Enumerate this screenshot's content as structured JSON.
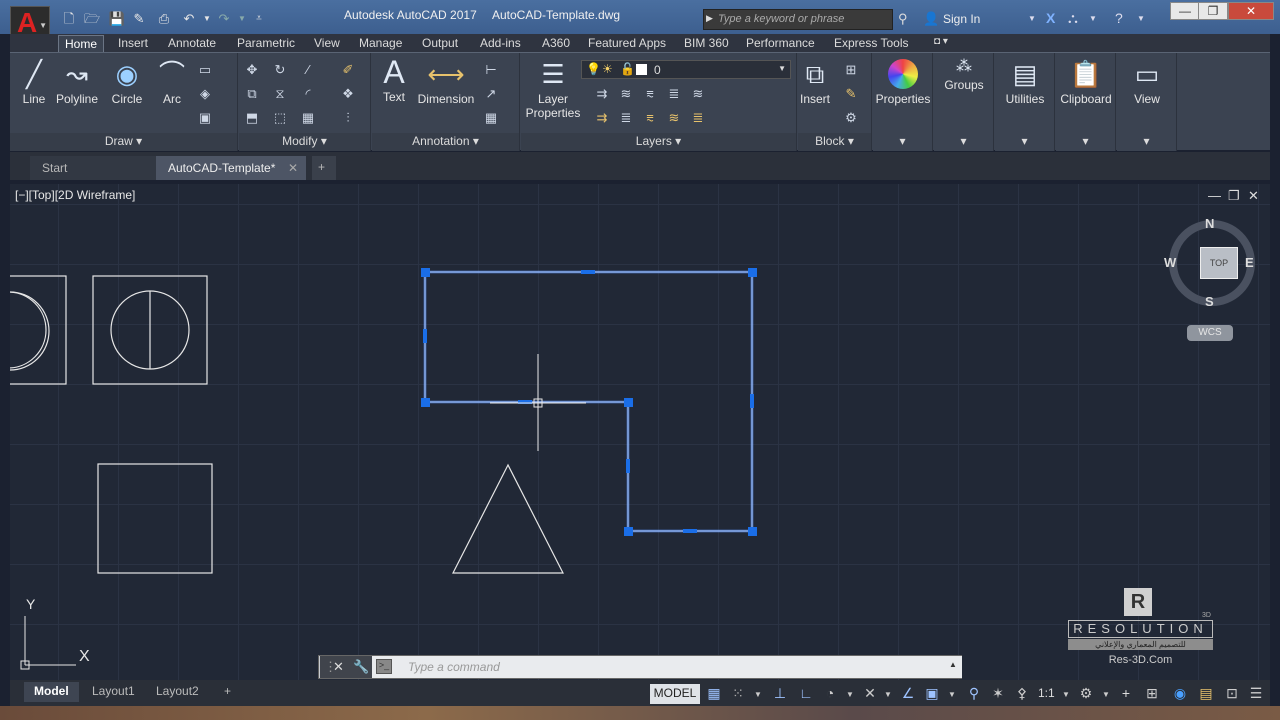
{
  "window": {
    "app_title": "Autodesk AutoCAD 2017",
    "file_title": "AutoCAD-Template.dwg",
    "search_placeholder": "Type a keyword or phrase",
    "sign_in": "Sign In"
  },
  "ribbon_tabs": [
    "Home",
    "Insert",
    "Annotate",
    "Parametric",
    "View",
    "Manage",
    "Output",
    "Add-ins",
    "A360",
    "Featured Apps",
    "BIM 360",
    "Performance",
    "Express Tools"
  ],
  "ribbon": {
    "draw": {
      "footer": "Draw",
      "line": "Line",
      "polyline": "Polyline",
      "circle": "Circle",
      "arc": "Arc"
    },
    "modify": {
      "footer": "Modify"
    },
    "annotation": {
      "footer": "Annotation",
      "text": "Text",
      "dimension": "Dimension"
    },
    "layers": {
      "footer": "Layers",
      "layer_properties_1": "Layer",
      "layer_properties_2": "Properties",
      "current_layer": "0"
    },
    "block": {
      "footer": "Block",
      "insert": "Insert"
    },
    "properties": "Properties",
    "groups": "Groups",
    "utilities": "Utilities",
    "clipboard": "Clipboard",
    "view": "View"
  },
  "doc_tabs": {
    "start": "Start",
    "active": "AutoCAD-Template*"
  },
  "viewport": {
    "label": "[−][Top][2D Wireframe]",
    "viewcube_face": "TOP",
    "compass": {
      "n": "N",
      "s": "S",
      "e": "E",
      "w": "W"
    },
    "wcs": "WCS",
    "ucs_x": "X",
    "ucs_y": "Y"
  },
  "command_line": {
    "placeholder": "Type a command"
  },
  "layout_tabs": {
    "model": "Model",
    "layout1": "Layout1",
    "layout2": "Layout2"
  },
  "status_bar": {
    "model": "MODEL",
    "scale": "1:1"
  },
  "watermark": {
    "letter": "R",
    "brand": "RESOLUTION",
    "superscript": "3D",
    "arabic": "للتصميم المعماري والإعلاني",
    "site": "Res-3D.Com"
  },
  "colors": {
    "canvas": "#212836",
    "selection": "#6fa8ff",
    "grip": "#1a6ee8",
    "ribbon": "#3b4351"
  }
}
